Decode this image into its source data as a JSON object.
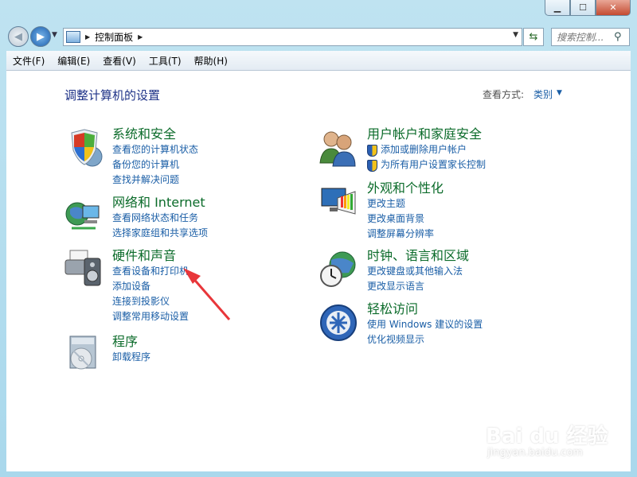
{
  "breadcrumb": {
    "current": "控制面板"
  },
  "search": {
    "placeholder": "搜索控制..."
  },
  "menu": [
    "文件(F)",
    "编辑(E)",
    "查看(V)",
    "工具(T)",
    "帮助(H)"
  ],
  "main": {
    "title": "调整计算机的设置",
    "view_by_label": "查看方式:",
    "view_by_value": "类别"
  },
  "categories": [
    {
      "title": "系统和安全",
      "icon": "shield-icon",
      "links": [
        "查看您的计算机状态",
        "备份您的计算机",
        "查找并解决问题"
      ]
    },
    {
      "title": "网络和 Internet",
      "icon": "network-globe-icon",
      "links": [
        "查看网络状态和任务",
        "选择家庭组和共享选项"
      ]
    },
    {
      "title": "硬件和声音",
      "icon": "printer-speaker-icon",
      "links": [
        "查看设备和打印机",
        "添加设备",
        "连接到投影仪",
        "调整常用移动设置"
      ]
    },
    {
      "title": "程序",
      "icon": "programs-disc-icon",
      "links": [
        "卸载程序"
      ]
    },
    {
      "title": "用户帐户和家庭安全",
      "icon": "users-icon",
      "links": [
        "添加或删除用户帐户",
        "为所有用户设置家长控制"
      ]
    },
    {
      "title": "外观和个性化",
      "icon": "monitor-palette-icon",
      "links": [
        "更改主题",
        "更改桌面背景",
        "调整屏幕分辨率"
      ]
    },
    {
      "title": "时钟、语言和区域",
      "icon": "clock-globe-icon",
      "links": [
        "更改键盘或其他输入法",
        "更改显示语言"
      ]
    },
    {
      "title": "轻松访问",
      "icon": "ease-of-access-icon",
      "links": [
        "使用 Windows 建议的设置",
        "优化视频显示"
      ]
    }
  ],
  "watermark": {
    "brand": "Bai du 经验",
    "url": "jingyan.baidu.com"
  },
  "colors": {
    "heading": "#1e3287",
    "category": "#0b6b2a",
    "link": "#1a5ea6",
    "annotation": "#e8363a"
  }
}
